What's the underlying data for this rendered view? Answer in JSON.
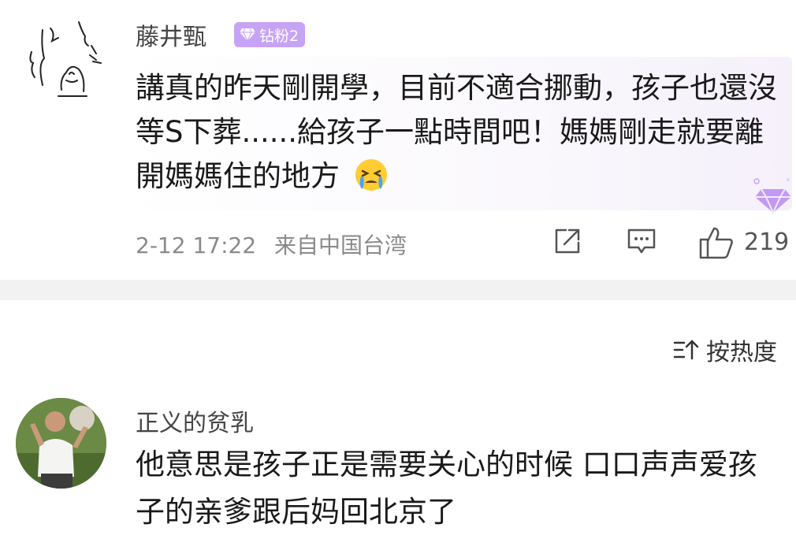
{
  "comment1": {
    "username": "藤井甄",
    "badge_label": "钻粉2",
    "text": "講真的昨天剛開學，目前不適合挪動，孩子也還沒等S下葬......給孩子一點時間吧！媽媽剛走就要離開媽媽住的地方",
    "emoji": "crying-face-icon",
    "time": "2-12 17:22",
    "location": "来自中国台湾",
    "like_count": "219"
  },
  "sort": {
    "label": "按热度"
  },
  "comment2": {
    "username": "正义的贫乳",
    "text": "他意思是孩子正是需要关心的时候 口口声声爱孩子的亲爹跟后妈回北京了"
  },
  "colors": {
    "badge": "#c7a3f5",
    "divider": "#f2f2f2",
    "meta": "#8a8a8a"
  }
}
